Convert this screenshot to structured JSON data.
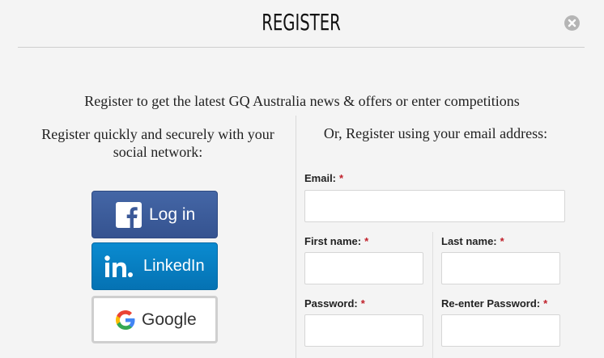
{
  "header": {
    "title": "REGISTER"
  },
  "intro": "Register to get the latest GQ Australia news & offers or enter competitions",
  "left": {
    "title": "Register quickly and securely with your social network:",
    "buttons": [
      {
        "label": "Log in",
        "icon": "facebook-icon",
        "color": "#3b5998"
      },
      {
        "label": "LinkedIn",
        "icon": "linkedin-icon",
        "color": "#0a7fc4"
      },
      {
        "label": "Google",
        "icon": "google-icon",
        "color": "#ffffff"
      }
    ]
  },
  "right": {
    "title": "Or, Register using your email address:",
    "fields": {
      "email": {
        "label": "Email:",
        "required": "*",
        "value": ""
      },
      "first_name": {
        "label": "First name:",
        "required": "*",
        "value": ""
      },
      "last_name": {
        "label": "Last name:",
        "required": "*",
        "value": ""
      },
      "password": {
        "label": "Password:",
        "required": "*",
        "value": ""
      },
      "reenter_password": {
        "label": "Re-enter Password:",
        "required": "*",
        "value": ""
      }
    }
  },
  "colors": {
    "required": "#c0202a",
    "background": "#f4f4f4"
  }
}
